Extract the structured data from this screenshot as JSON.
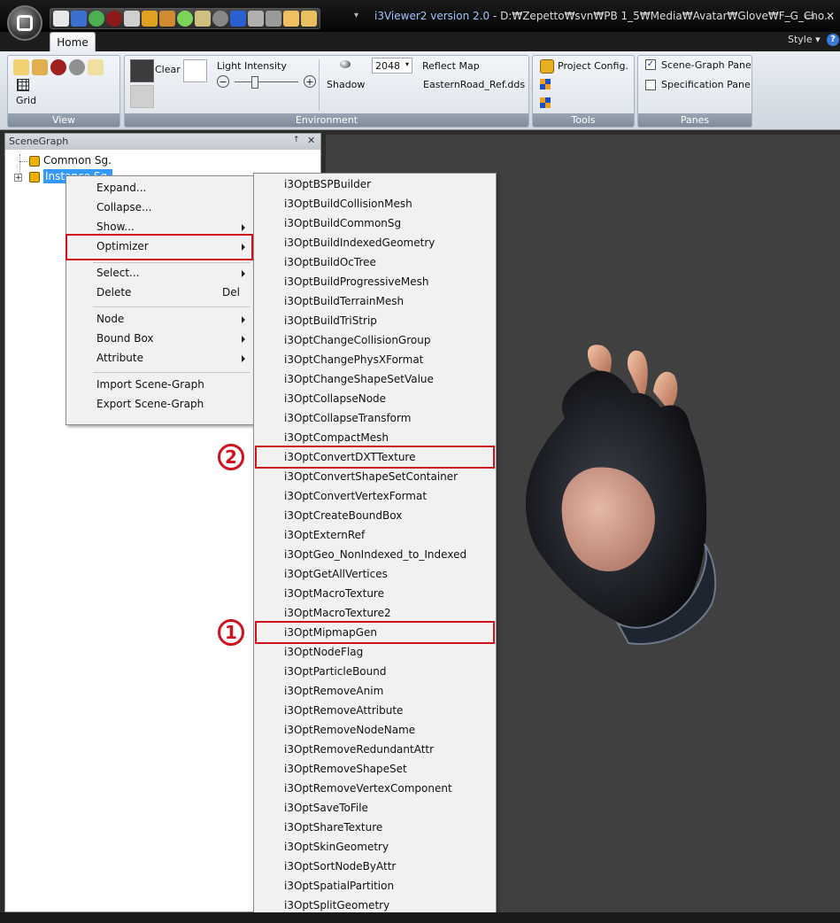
{
  "window": {
    "title_app": "i3Viewer2",
    "title_version": "version 2.0",
    "title_path": "- D:₩Zepetto₩svn₩PB 1_5₩Media₩Avatar₩Glove₩F_G_Cho..."
  },
  "ribbon": {
    "tab_home": "Home",
    "style_label": "Style",
    "help_glyph": "?",
    "view": {
      "grid_label": "Grid",
      "caption": "View"
    },
    "environment": {
      "clear_label": "Clear",
      "light_intensity_label": "Light Intensity",
      "minus_glyph": "−",
      "plus_glyph": "+",
      "shadow_label": "Shadow",
      "shadow_size": "2048",
      "reflect_map_label": "Reflect Map",
      "reflect_map_file": "EasternRoad_Ref.dds",
      "caption": "Environment"
    },
    "tools": {
      "project_config_label": "Project Config.",
      "caption": "Tools"
    },
    "panes": {
      "scene_graph_pane_label": "Scene-Graph Pane",
      "scene_graph_pane_checked": true,
      "specification_pane_label": "Specification Pane",
      "specification_pane_checked": false,
      "check_glyph": "✓",
      "caption": "Panes"
    }
  },
  "scene_graph": {
    "header": "SceneGraph",
    "pin_glyph": "↑",
    "close_glyph": "✕",
    "nodes": [
      {
        "label": "Common Sg."
      },
      {
        "label": "Instance Sg."
      }
    ]
  },
  "context_menu": {
    "items": [
      {
        "label": "Expand..."
      },
      {
        "label": "Collapse..."
      },
      {
        "label": "Show..."
      },
      {
        "label": "Optimizer"
      },
      {
        "label": "Select..."
      },
      {
        "label": "Delete",
        "shortcut": "Del"
      },
      {
        "label": "Node"
      },
      {
        "label": "Bound Box"
      },
      {
        "label": "Attribute"
      },
      {
        "label": "Import Scene-Graph"
      },
      {
        "label": "Export Scene-Graph"
      }
    ]
  },
  "optimizer_submenu": {
    "items": [
      "i3OptBSPBuilder",
      "i3OptBuildCollisionMesh",
      "i3OptBuildCommonSg",
      "i3OptBuildIndexedGeometry",
      "i3OptBuildOcTree",
      "i3OptBuildProgressiveMesh",
      "i3OptBuildTerrainMesh",
      "i3OptBuildTriStrip",
      "i3OptChangeCollisionGroup",
      "i3OptChangePhysXFormat",
      "i3OptChangeShapeSetValue",
      "i3OptCollapseNode",
      "i3OptCollapseTransform",
      "i3OptCompactMesh",
      "i3OptConvertDXTTexture",
      "i3OptConvertShapeSetContainer",
      "i3OptConvertVertexFormat",
      "i3OptCreateBoundBox",
      "i3OptExternRef",
      "i3OptGeo_NonIndexed_to_Indexed",
      "i3OptGetAllVertices",
      "i3OptMacroTexture",
      "i3OptMacroTexture2",
      "i3OptMipmapGen",
      "i3OptNodeFlag",
      "i3OptParticleBound",
      "i3OptRemoveAnim",
      "i3OptRemoveAttribute",
      "i3OptRemoveNodeName",
      "i3OptRemoveRedundantAttr",
      "i3OptRemoveShapeSet",
      "i3OptRemoveVertexComponent",
      "i3OptSaveToFile",
      "i3OptShareTexture",
      "i3OptSkinGeometry",
      "i3OptSortNodeByAttr",
      "i3OptSpatialPartition",
      "i3OptSplitGeometry"
    ]
  },
  "annotations": {
    "badge_1": "1",
    "badge_2": "2",
    "color": "#d0101c"
  }
}
